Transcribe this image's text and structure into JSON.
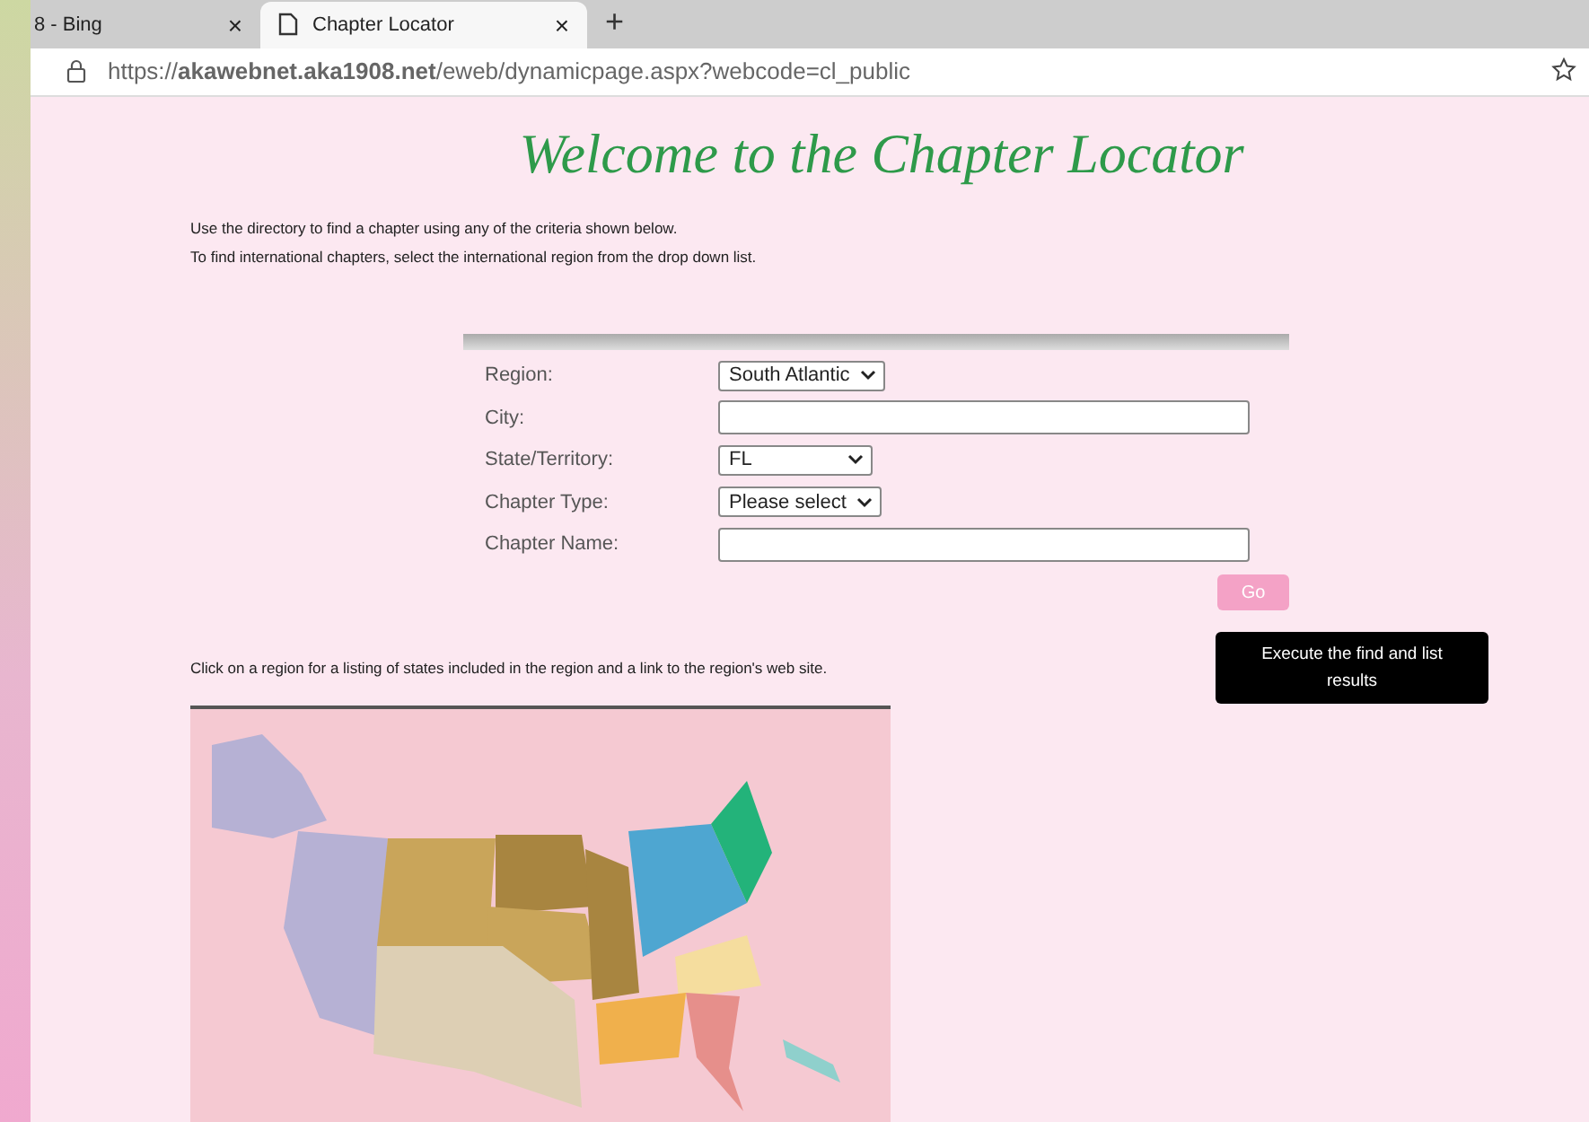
{
  "browser": {
    "tabs": [
      {
        "title": "8 - Bing",
        "close": "×",
        "selected": false
      },
      {
        "title": "Chapter Locator",
        "close": "×",
        "selected": true
      }
    ],
    "new_tab": "+",
    "address": "https://**akawebnet.aka1908.net**/eweb/dynamicpage.aspx?webcode=cl_public"
  },
  "page": {
    "title": "Welcome to the Chapter Locator",
    "intro": [
      "Use the directory to find a chapter using any of the criteria shown below.",
      "To find international chapters, select the international region from the drop down list."
    ],
    "form": {
      "fields": [
        {
          "label": "Region:",
          "kind": "select",
          "value": "South Atlantic"
        },
        {
          "label": "City:",
          "kind": "text"
        },
        {
          "label": "State/Territory:",
          "kind": "select",
          "value": "FL"
        },
        {
          "label": "Chapter Type:",
          "kind": "select",
          "value": "Please select"
        },
        {
          "label": "Chapter Name:",
          "kind": "text"
        }
      ],
      "go_button": "Go",
      "tooltip": "Execute the find and list results"
    },
    "map_caption": "Click on a region for a listing of states included in the region and a link to the region's web site."
  }
}
